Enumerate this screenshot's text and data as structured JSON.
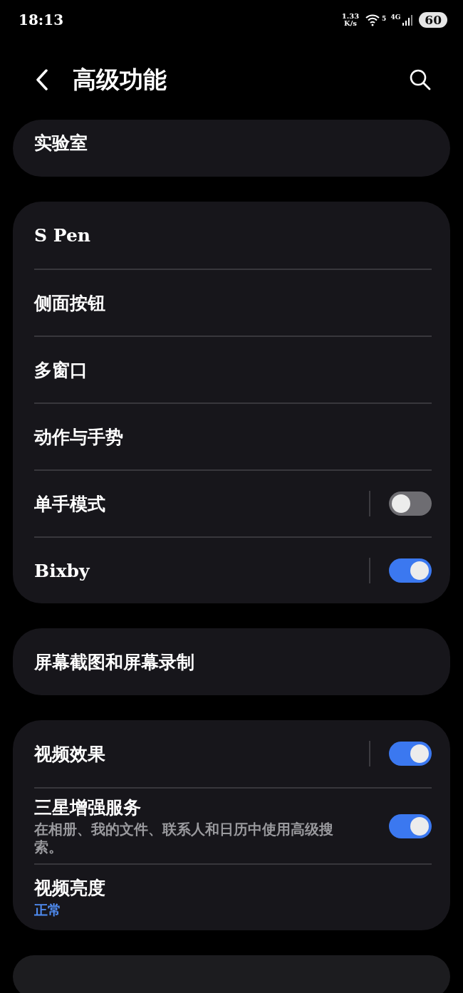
{
  "status_bar": {
    "time": "18:13",
    "speed_value": "1.33",
    "speed_unit": "K/s",
    "wifi_label": "5",
    "network": "4G",
    "battery": "60"
  },
  "header": {
    "title": "高级功能"
  },
  "groups": [
    {
      "items": [
        {
          "kind": "plain",
          "label": "实验室"
        }
      ]
    },
    {
      "items": [
        {
          "kind": "plain",
          "label": "S Pen"
        },
        {
          "kind": "plain",
          "label": "侧面按钮"
        },
        {
          "kind": "plain",
          "label": "多窗口"
        },
        {
          "kind": "plain",
          "label": "动作与手势"
        },
        {
          "kind": "toggle",
          "label": "单手模式",
          "on": false
        },
        {
          "kind": "toggle",
          "label": "Bixby",
          "on": true
        }
      ]
    },
    {
      "items": [
        {
          "kind": "plain",
          "label": "屏幕截图和屏幕录制"
        }
      ]
    },
    {
      "items": [
        {
          "kind": "toggle",
          "label": "视频效果",
          "on": true
        },
        {
          "kind": "toggle_sub",
          "label": "三星增强服务",
          "subtitle": "在相册、我的文件、联系人和日历中使用高级搜索。",
          "on": true
        },
        {
          "kind": "value",
          "label": "视频亮度",
          "value": "正常"
        }
      ]
    },
    {
      "kind": "cut_off"
    }
  ]
}
